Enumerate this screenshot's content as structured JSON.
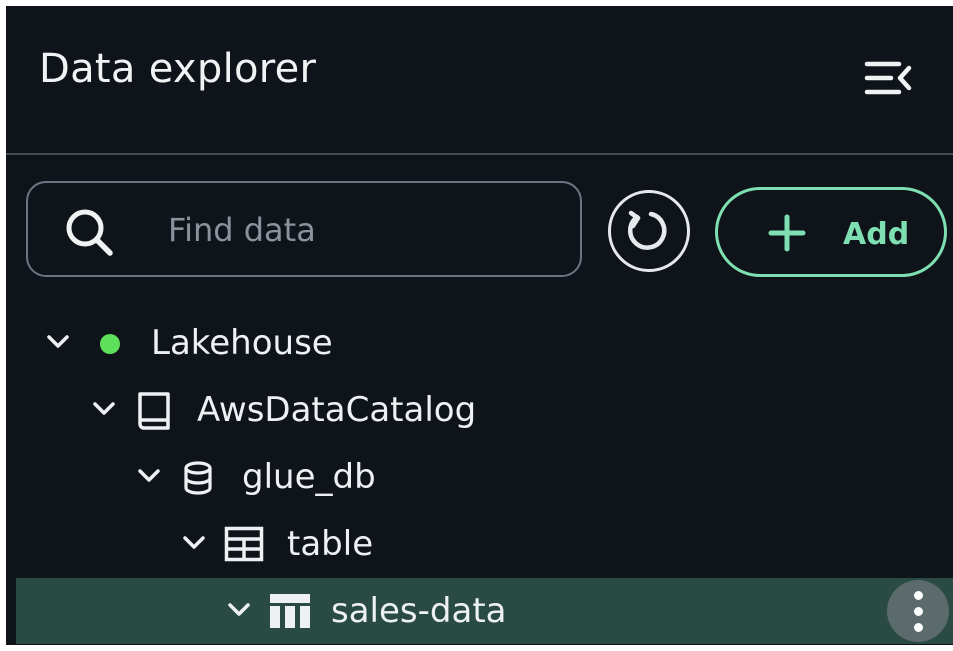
{
  "header": {
    "title": "Data explorer"
  },
  "toolbar": {
    "search_placeholder": "Find data",
    "search_value": "",
    "add_label": "Add"
  },
  "tree": {
    "lakehouse": {
      "label": "Lakehouse",
      "status_color": "#5ee05a"
    },
    "catalog": {
      "label": "AwsDataCatalog",
      "icon": "book-icon"
    },
    "database": {
      "label": "glue_db",
      "icon": "database-icon"
    },
    "folder": {
      "label": "table",
      "icon": "grid-table-icon"
    },
    "item": {
      "label": "sales-data",
      "icon": "table-icon",
      "selected": true
    }
  },
  "colors": {
    "background": "#0f141a",
    "accent": "#7ee0b2",
    "selected_row": "#2a4a44"
  }
}
